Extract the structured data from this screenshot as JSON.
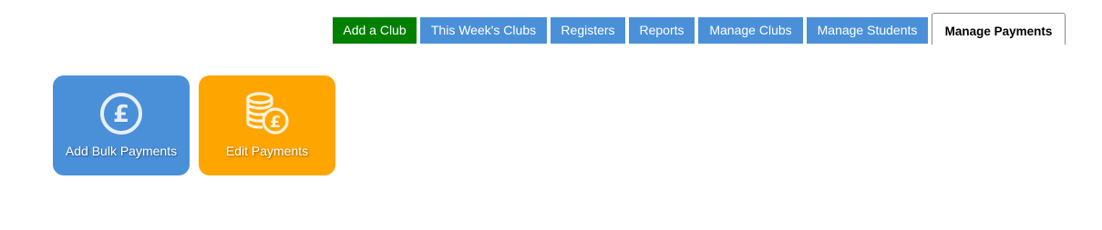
{
  "nav": {
    "tabs": [
      {
        "id": "add-a-club",
        "label": "Add a Club",
        "color": "#008000"
      },
      {
        "id": "this-weeks-clubs",
        "label": "This Week's Clubs",
        "color": "#4a90d9"
      },
      {
        "id": "registers",
        "label": "Registers",
        "color": "#4a90d9"
      },
      {
        "id": "reports",
        "label": "Reports",
        "color": "#4a90d9"
      },
      {
        "id": "manage-clubs",
        "label": "Manage Clubs",
        "color": "#4a90d9"
      },
      {
        "id": "manage-students",
        "label": "Manage Students",
        "color": "#4a90d9"
      },
      {
        "id": "manage-payments",
        "label": "Manage Payments",
        "active": true
      }
    ]
  },
  "tiles": [
    {
      "label": "Add Bulk Payments",
      "icon": "pound-coin-icon",
      "color": "#4a90d9"
    },
    {
      "label": "Edit Payments",
      "icon": "coin-stack-pound-icon",
      "color": "#ffa500"
    }
  ]
}
